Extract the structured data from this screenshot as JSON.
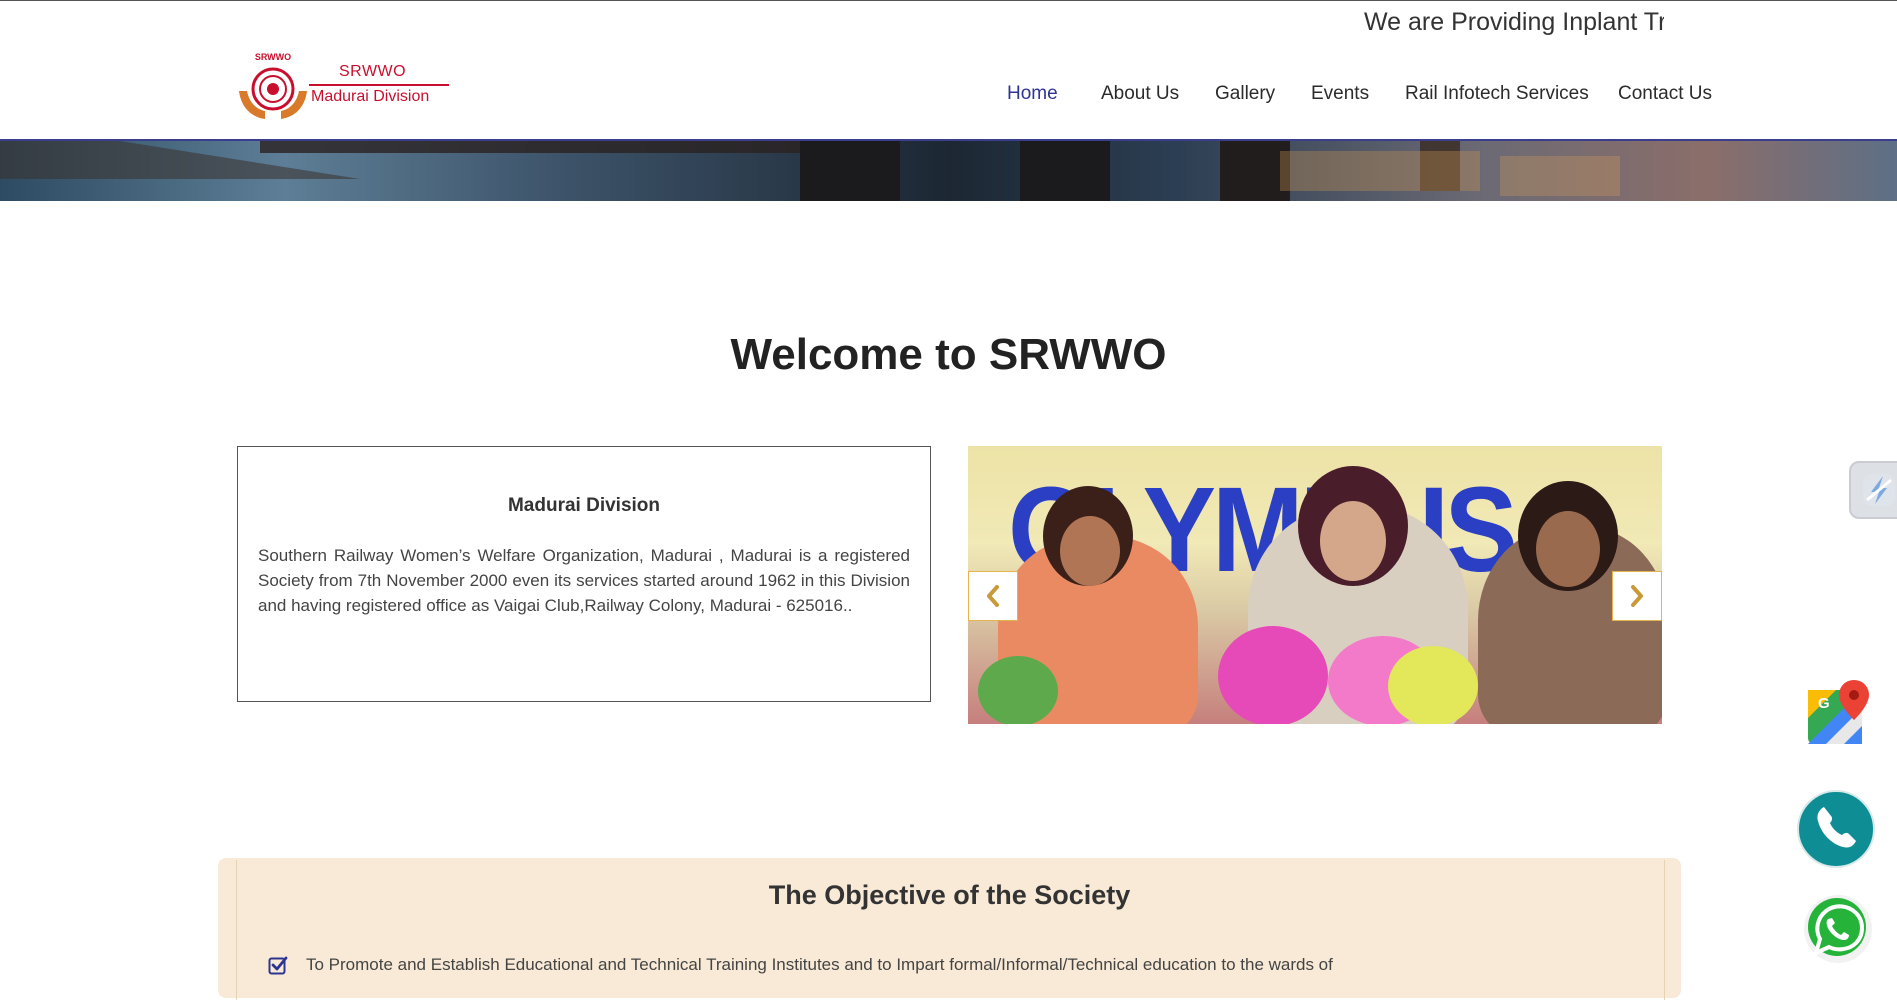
{
  "header": {
    "marquee_text": "We are Providing Inplant Tr",
    "logo": {
      "line1": "SRWWO",
      "line2": "Madurai Division"
    },
    "nav": [
      {
        "label": "Home",
        "active": true
      },
      {
        "label": "About Us",
        "active": false
      },
      {
        "label": "Gallery",
        "active": false
      },
      {
        "label": "Events",
        "active": false
      },
      {
        "label": "Rail Infotech Services",
        "active": false
      },
      {
        "label": "Contact Us",
        "active": false
      }
    ]
  },
  "welcome": {
    "heading": "Welcome to SRWWO",
    "about_title": "Madurai Division",
    "about_text": "Southern Railway Women’s Welfare Organization, Madurai , Madurai is a registered Society from 7th November 2000 even its services started around 1962 in this Division and having registered office as Vaigai Club,Railway Colony, Madurai - 625016.."
  },
  "slider": {
    "banner_text": "OLYMPUS",
    "prev_icon": "chevron-left-icon",
    "next_icon": "chevron-right-icon"
  },
  "objective": {
    "title": "The Objective of the Society",
    "items": [
      "To Promote and Establish Educational and Technical Training Institutes and to Impart formal/Informal/Technical education to the wards of"
    ]
  },
  "floating": {
    "icons": [
      "lightning-icon",
      "google-maps-icon",
      "phone-icon",
      "whatsapp-icon"
    ]
  },
  "colors": {
    "nav_active": "#2e3591",
    "logo_red": "#c8102e",
    "objective_bg": "#f8ead6",
    "slider_button_border": "#e6b44c",
    "phone_teal": "#0e8e94",
    "whatsapp_green": "#25b33a"
  }
}
